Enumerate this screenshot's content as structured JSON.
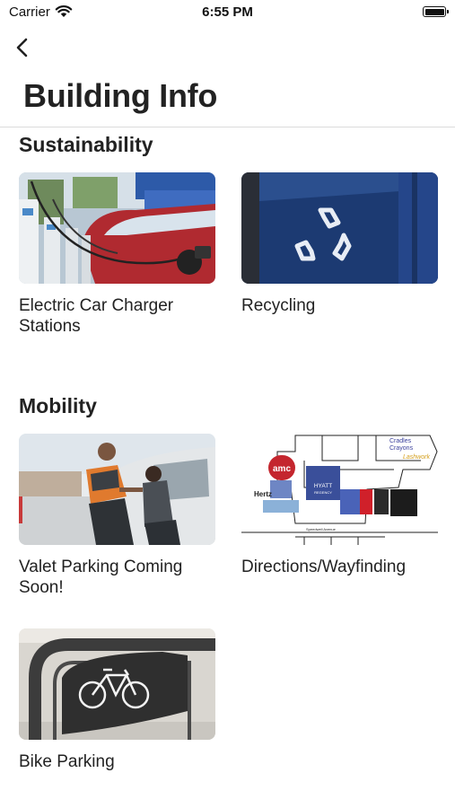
{
  "status_bar": {
    "carrier": "Carrier",
    "time": "6:55 PM"
  },
  "header": {
    "title": "Building Info"
  },
  "sections": [
    {
      "title": "Sustainability",
      "items": [
        {
          "label": "Electric Car Charger Stations",
          "icon": "ev-charger-photo"
        },
        {
          "label": "Recycling",
          "icon": "recycling-bin-photo"
        }
      ]
    },
    {
      "title": "Mobility",
      "items": [
        {
          "label": "Valet Parking Coming Soon!",
          "icon": "valet-photo"
        },
        {
          "label": "Directions/Wayfinding",
          "icon": "map-photo"
        },
        {
          "label": "Bike Parking",
          "icon": "bike-rack-photo"
        }
      ]
    }
  ],
  "map_labels": {
    "amc": "amc",
    "hyatt": "HYATT",
    "hyatt_sub": "REGENCY",
    "hertz": "Hertz",
    "cradles": "Cradles",
    "crayons": "Crayons",
    "speedwell": "Speedwell Avenue"
  }
}
